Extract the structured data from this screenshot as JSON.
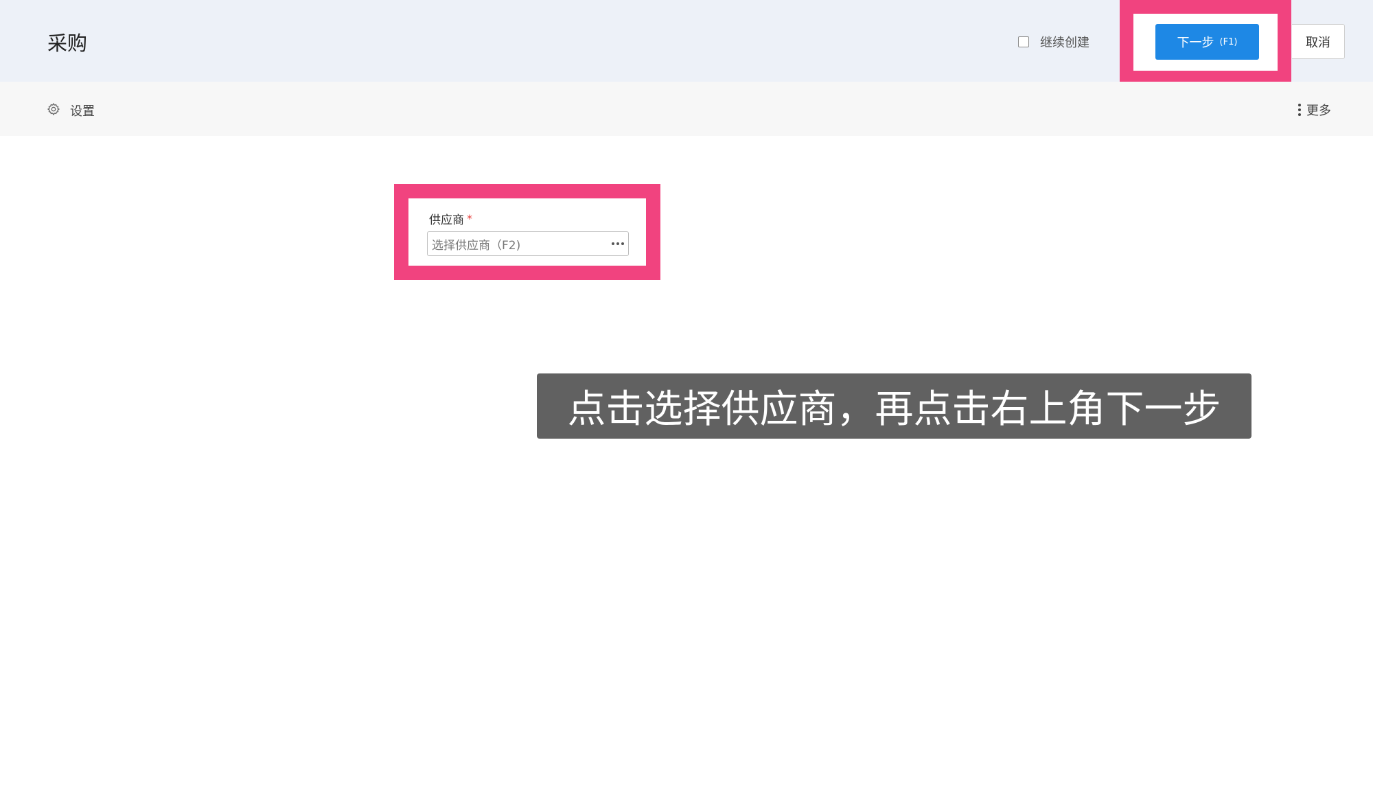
{
  "header": {
    "title": "采购",
    "continue_create_label": "继续创建",
    "continue_create_checked": false,
    "next_label": "下一步",
    "next_shortcut": "(F1)",
    "cancel_label": "取消"
  },
  "toolbar": {
    "settings_label": "设置",
    "settings_icon": "gear-icon",
    "more_label": "更多",
    "more_icon": "vertical-dots-icon"
  },
  "form": {
    "supplier_label": "供应商",
    "required_mark": "*",
    "supplier_placeholder": "选择供应商（F2)",
    "supplier_value": "",
    "picker_icon": "ellipsis-icon"
  },
  "caption": {
    "text": "点击选择供应商，再点击右上角下一步"
  },
  "colors": {
    "highlight": "#f1437f",
    "primary": "#1e88e5",
    "header_bg": "#edf1f8",
    "caption_bg": "#616161"
  }
}
